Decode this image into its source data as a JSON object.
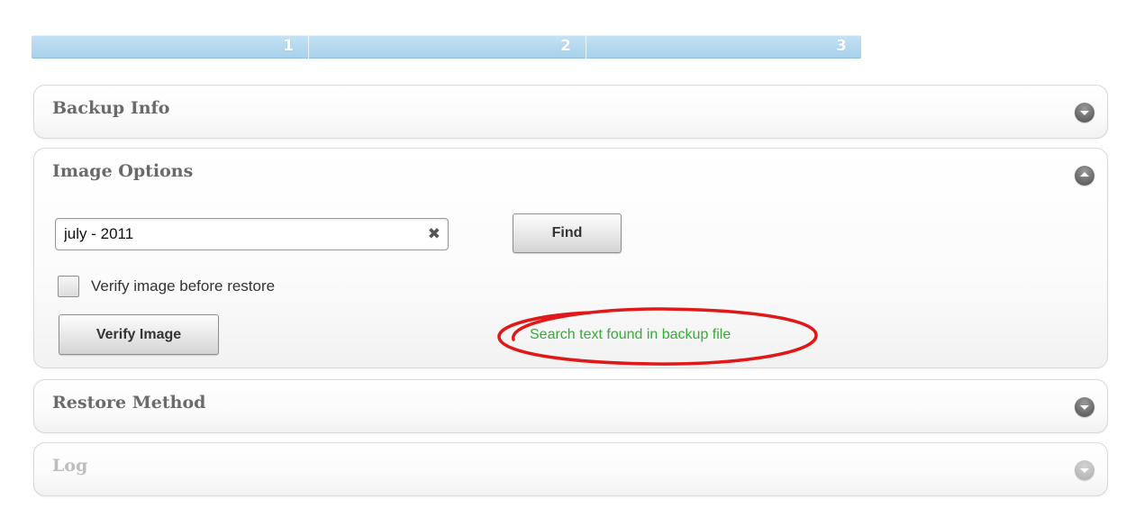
{
  "steps": [
    "1",
    "2",
    "3"
  ],
  "panels": {
    "backup_info": {
      "title": "Backup Info"
    },
    "image_options": {
      "title": "Image Options",
      "search": {
        "value": "july - 2011",
        "placeholder": ""
      },
      "find_label": "Find",
      "verify_checkbox_label": "Verify image before restore",
      "verify_checked": false,
      "verify_button_label": "Verify Image",
      "status_text": "Search text found in backup file"
    },
    "restore_method": {
      "title": "Restore Method"
    },
    "log": {
      "title": "Log",
      "disabled": true
    }
  },
  "colors": {
    "step_bar": "#b3d8f0",
    "status_text": "#3aa83a",
    "highlight_ring": "#e01818",
    "panel_title": "#6a6a6a",
    "panel_title_disabled": "#bdbdbd"
  },
  "icons": {
    "collapsed_toggle": "chevron-down-icon",
    "expanded_toggle": "chevron-up-icon",
    "clear_search": "close-icon"
  }
}
